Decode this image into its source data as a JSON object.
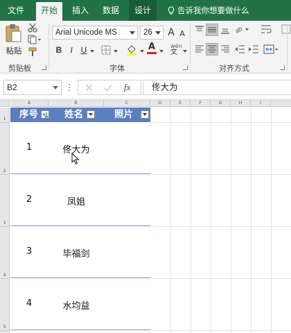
{
  "tabs": {
    "file": "文件",
    "home": "开始",
    "insert": "插入",
    "data": "数据",
    "design": "设计"
  },
  "tell_me": "告诉我你想要做什么",
  "ribbon": {
    "clipboard": {
      "paste_label": "粘贴",
      "group_label": "剪贴板"
    },
    "font": {
      "font_name": "Arial Unicode MS",
      "font_size": "26",
      "grow": "A",
      "shrink": "A",
      "bold": "B",
      "italic": "I",
      "underline": "U",
      "phonetic": "wén",
      "group_label": "字体"
    },
    "alignment": {
      "group_label": "对齐方式"
    }
  },
  "formula_bar": {
    "name_box": "B2",
    "fx": "fx",
    "formula": "佟大为"
  },
  "columns": [
    "A",
    "B",
    "C",
    "D",
    "E",
    "F",
    "G",
    "H",
    "I"
  ],
  "rows": [
    "1",
    "2",
    "3",
    "4",
    "5"
  ],
  "table": {
    "headers": [
      "序号",
      "姓名",
      "照片"
    ],
    "rows": [
      {
        "num": "1",
        "name": "佟大为"
      },
      {
        "num": "2",
        "name": "凤姐"
      },
      {
        "num": "3",
        "name": "毕福剑"
      },
      {
        "num": "4",
        "name": "水均益"
      }
    ]
  },
  "colors": {
    "ribbon_green": "#217346",
    "header_blue": "#5a7fbf",
    "row_border": "#6f93cf"
  }
}
